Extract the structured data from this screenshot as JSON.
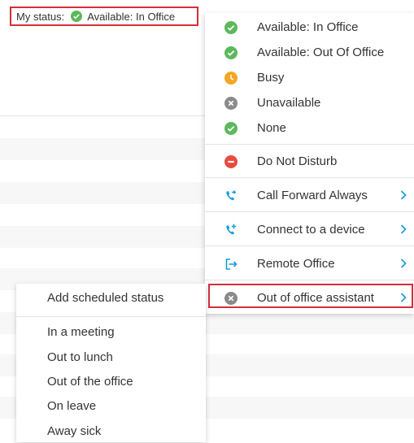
{
  "status_bar": {
    "label": "My status:",
    "value": "Available: In Office",
    "icon": "check-circle-icon",
    "color": "#5cb85c"
  },
  "status_menu": {
    "items": [
      {
        "label": "Available: In Office",
        "icon": "check-circle-icon",
        "color": "#5cb85c"
      },
      {
        "label": "Available: Out Of Office",
        "icon": "check-circle-icon",
        "color": "#5cb85c"
      },
      {
        "label": "Busy",
        "icon": "clock-icon",
        "color": "#f5a623"
      },
      {
        "label": "Unavailable",
        "icon": "x-circle-icon",
        "color": "#8a8a8a"
      },
      {
        "label": "None",
        "icon": "check-circle-icon",
        "color": "#5cb85c"
      },
      {
        "label": "Do Not Disturb",
        "icon": "minus-circle-icon",
        "color": "#e74c3c"
      },
      {
        "label": "Call Forward Always",
        "icon": "phone-forward-icon",
        "color": "#1a9bd7"
      },
      {
        "label": "Connect to a device",
        "icon": "phone-add-icon",
        "color": "#1a9bd7"
      },
      {
        "label": "Remote Office",
        "icon": "exit-icon",
        "color": "#1a9bd7"
      },
      {
        "label": "Out of office assistant",
        "icon": "x-circle-icon",
        "color": "#8a8a8a"
      }
    ]
  },
  "ooo_submenu": {
    "header": "Add scheduled status",
    "items": [
      "In a meeting",
      "Out to lunch",
      "Out of the office",
      "On leave",
      "Away sick"
    ]
  },
  "colors": {
    "highlight_border": "#d32f3a",
    "accent_blue": "#1a9bd7"
  }
}
